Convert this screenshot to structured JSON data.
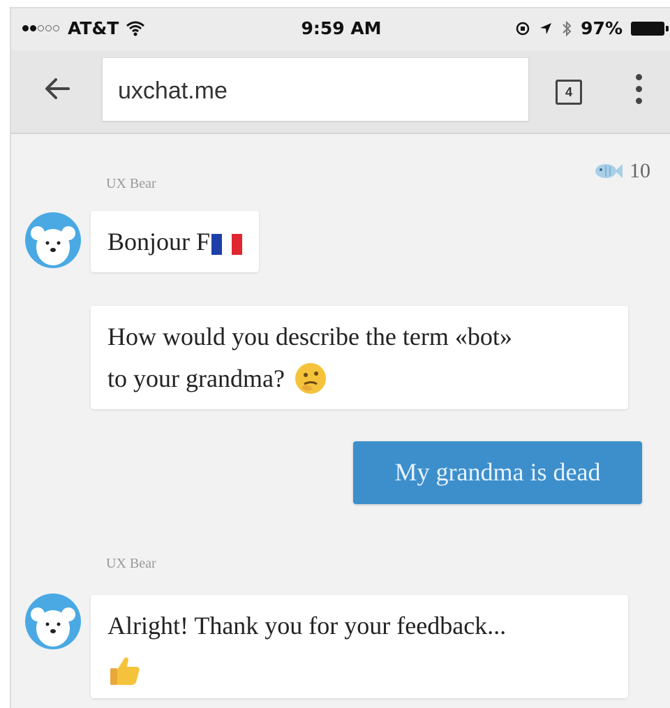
{
  "status_bar": {
    "carrier": "AT&T",
    "time": "9:59 AM",
    "battery": "97%",
    "signal_bars_filled": 2,
    "signal_bars_total": 5
  },
  "browser": {
    "url": "uxchat.me",
    "tab_count": "4"
  },
  "chat": {
    "coins": "10",
    "messages": [
      {
        "sender": "UX Bear",
        "text": "Bonjour F"
      },
      {
        "text": "How would you describe the term «bot»",
        "text2": "to your grandma?"
      },
      {
        "text": "My grandma is dead"
      },
      {
        "sender": "UX Bear",
        "text": "Alright! Thank you for your feedback..."
      }
    ]
  },
  "colors": {
    "user_bubble": "#3d8fcb",
    "avatar": "#4aa9e3"
  }
}
